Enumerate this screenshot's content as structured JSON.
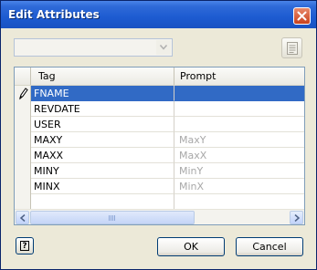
{
  "window": {
    "title": "Edit Attributes"
  },
  "toolbar": {
    "combo_value": ""
  },
  "grid": {
    "columns": [
      "Tag",
      "Prompt"
    ],
    "rows": [
      {
        "tag": "FNAME",
        "prompt": "",
        "selected": true
      },
      {
        "tag": "REVDATE",
        "prompt": ""
      },
      {
        "tag": "USER",
        "prompt": ""
      },
      {
        "tag": "MAXY",
        "prompt": "MaxY"
      },
      {
        "tag": "MAXX",
        "prompt": "MaxX"
      },
      {
        "tag": "MINY",
        "prompt": "MinY"
      },
      {
        "tag": "MINX",
        "prompt": "MinX"
      },
      {
        "tag": "",
        "prompt": ""
      }
    ]
  },
  "buttons": {
    "ok": "OK",
    "cancel": "Cancel",
    "help": "?"
  },
  "colors": {
    "titlebar": "#1d5bd1",
    "selection": "#316ac5",
    "dialog_bg": "#ece9d8"
  },
  "icons": {
    "close": "close-icon",
    "edit": "document-icon",
    "row_indicator": "pencil-icon",
    "help": "help-icon"
  }
}
